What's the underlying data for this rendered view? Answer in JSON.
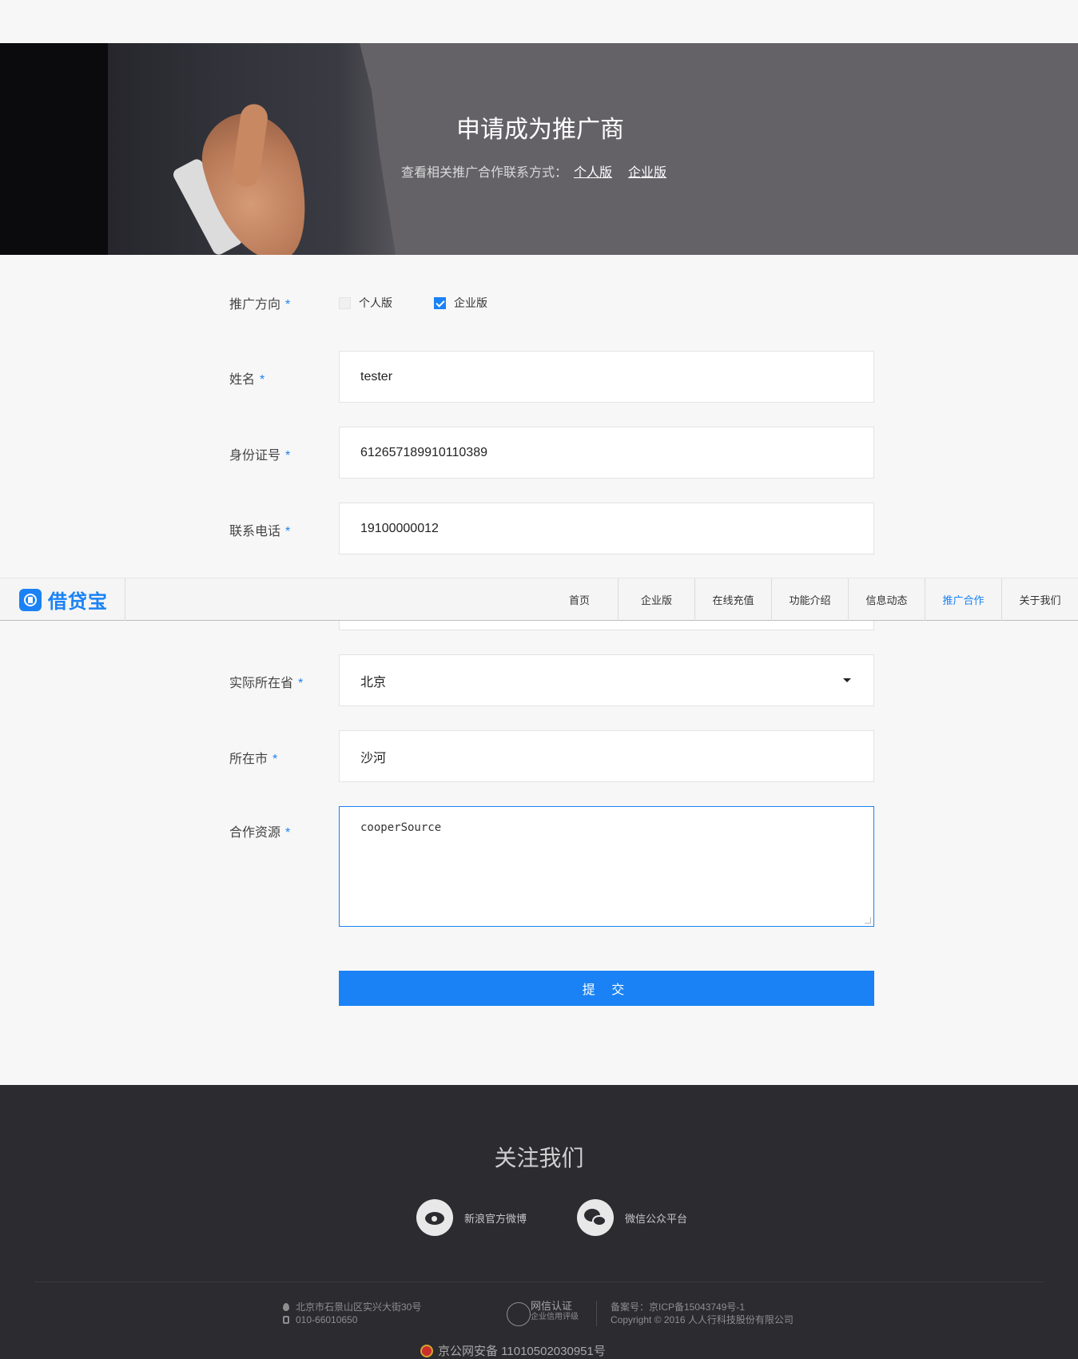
{
  "hero": {
    "title": "申请成为推广商",
    "subtitle": "查看相关推广合作联系方式：",
    "link_personal": "个人版",
    "link_enterprise": "企业版"
  },
  "form": {
    "direction": {
      "label": "推广方向",
      "options": [
        {
          "label": "个人版",
          "checked": false
        },
        {
          "label": "企业版",
          "checked": true
        }
      ]
    },
    "name": {
      "label": "姓名",
      "value": "tester"
    },
    "id_number": {
      "label": "身份证号",
      "value": "612657189910110389"
    },
    "phone": {
      "label": "联系电话",
      "value": "19100000012"
    },
    "province": {
      "label": "实际所在省",
      "value": "北京"
    },
    "city": {
      "label": "所在市",
      "value": "沙河"
    },
    "resource": {
      "label": "合作资源",
      "value": "cooperSource"
    },
    "required_mark": "*",
    "submit_label": "提 交"
  },
  "nav": {
    "brand": "借贷宝",
    "items": [
      {
        "label": "首页",
        "active": false
      },
      {
        "label": "企业版",
        "active": false
      },
      {
        "label": "在线充值",
        "active": false
      },
      {
        "label": "功能介绍",
        "active": false
      },
      {
        "label": "信息动态",
        "active": false
      },
      {
        "label": "推广合作",
        "active": true
      },
      {
        "label": "关于我们",
        "active": false
      }
    ]
  },
  "footer": {
    "follow_title": "关注我们",
    "weibo": "新浪官方微博",
    "wechat": "微信公众平台",
    "address": "北京市石景山区实兴大街30号",
    "phone": "010-66010650",
    "cert_title": "网信认证",
    "cert_sub": "企业信用评级",
    "icp": "备案号：京ICP备15043749号-1",
    "copyright": "Copyright © 2016 人人行科技股份有限公司",
    "police": "京公网安备 11010502030951号"
  },
  "colors": {
    "accent": "#1a82f5",
    "hero_bg": "#646267",
    "footer_bg": "#2b2b30"
  }
}
